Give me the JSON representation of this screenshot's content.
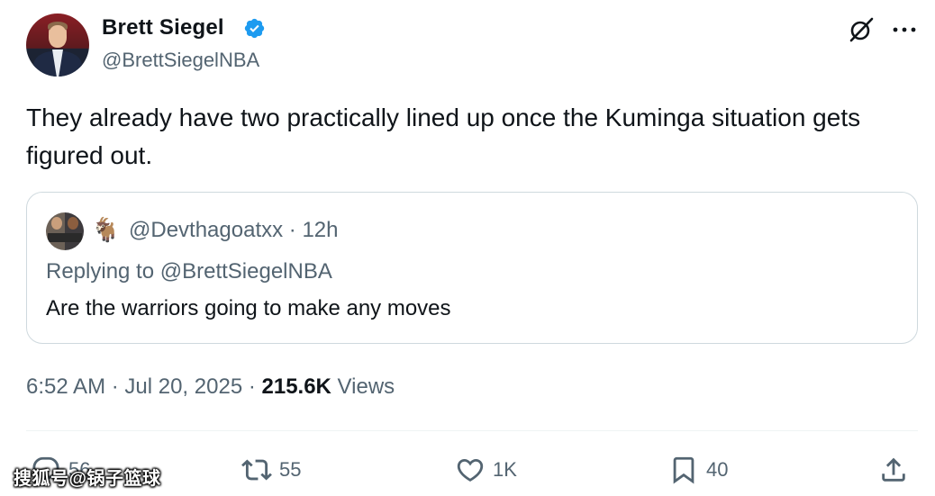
{
  "author": {
    "display_name": "Brett Siegel",
    "handle": "@BrettSiegelNBA",
    "verified": true
  },
  "tweet": {
    "text": "They already have two practically lined up once the Kuminga situation gets figured out."
  },
  "quote": {
    "emoji": "🐐",
    "handle_time": "@Devthagoatxx · 12h",
    "replying_prefix": "Replying to ",
    "replying_to": "@BrettSiegelNBA",
    "text": "Are the warriors going to make any moves"
  },
  "meta": {
    "time": "6:52 AM",
    "separator1": " · ",
    "date": "Jul 20, 2025",
    "separator2": " · ",
    "views_count": "215.6K",
    "views_label": " Views"
  },
  "actions": {
    "reply_count": "56",
    "retweet_count": "55",
    "like_count": "1K",
    "bookmark_count": "40"
  },
  "icons": {
    "verified": "verified-badge-icon",
    "grok": "grok-icon",
    "more": "more-icon",
    "reply": "reply-icon",
    "retweet": "retweet-icon",
    "like": "heart-icon",
    "bookmark": "bookmark-icon",
    "share": "share-icon"
  },
  "colors": {
    "verified": "#1d9bf0",
    "secondary_text": "#536471",
    "primary_text": "#0f1419",
    "border": "#cfd9de"
  },
  "watermark": "搜狐号@锅子篮球"
}
